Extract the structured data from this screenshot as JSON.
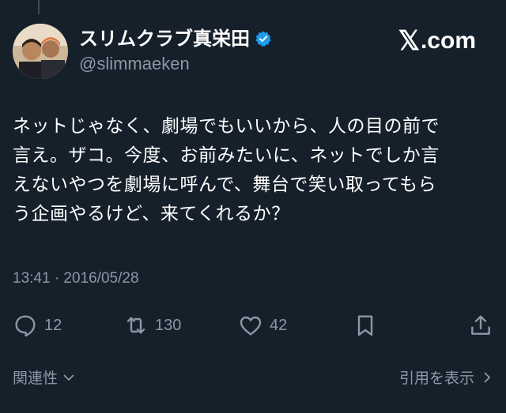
{
  "user": {
    "display_name": "スリムクラブ真栄田",
    "handle": "@slimmaeken",
    "verified": true
  },
  "site_logo": {
    "mark": "𝕏",
    "text": ".com"
  },
  "tweet": {
    "lines": [
      "ネットじゃなく、劇場でもいいから、人の目の前で",
      "言え。ザコ。今度、お前みたいに、ネットでしか言",
      "えないやつを劇場に呼んで、舞台で笑い取ってもら",
      "う企画やるけど、来てくれるか？"
    ],
    "timestamp": "13:41 · 2016/05/28"
  },
  "actions": {
    "reply_count": "12",
    "retweet_count": "130",
    "like_count": "42"
  },
  "footer": {
    "related_label": "関連性",
    "quotes_label": "引用を表示"
  },
  "colors": {
    "background": "#15202b",
    "secondary_text": "#8b98a5",
    "verified": "#1d9bf0"
  },
  "icons": [
    "reply-icon",
    "retweet-icon",
    "like-icon",
    "bookmark-icon",
    "share-icon",
    "verified-icon",
    "chevron-down-icon",
    "chevron-right-icon"
  ]
}
